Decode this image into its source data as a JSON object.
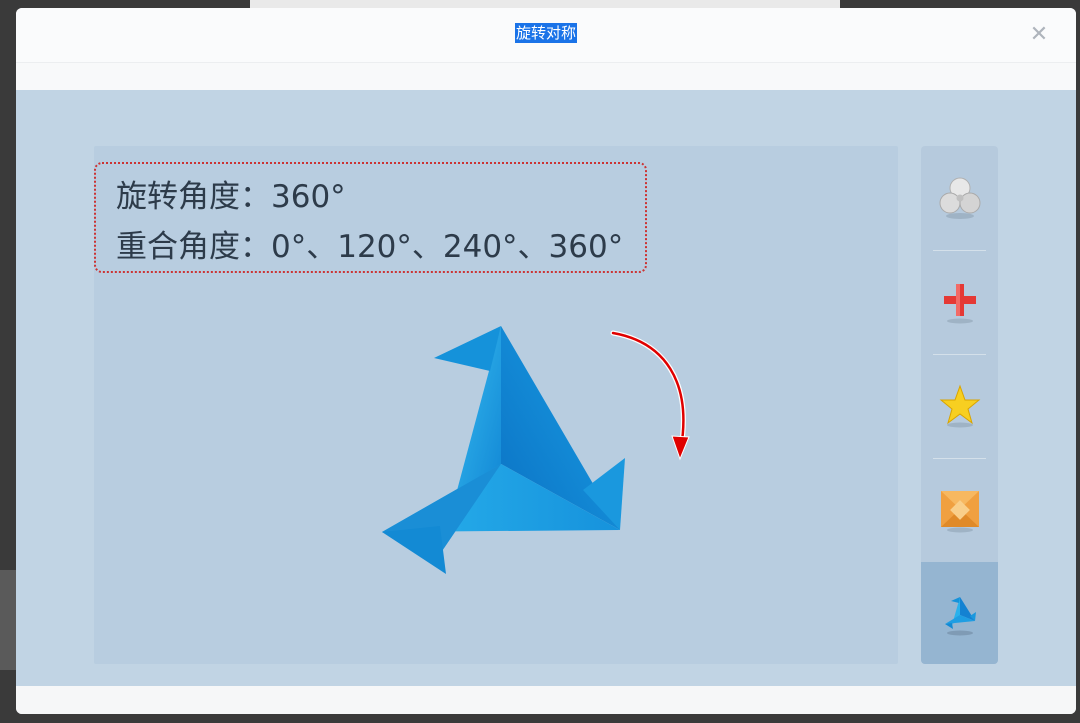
{
  "window": {
    "title": "旋转对称"
  },
  "info": {
    "rotation_label": "旋转角度：",
    "rotation_value": "360°",
    "overlap_label": "重合角度：",
    "overlap_value": "0°、120°、240°、360°"
  },
  "sidebar": {
    "items": [
      {
        "name": "fan",
        "icon": "fan-icon",
        "active": false
      },
      {
        "name": "cross",
        "icon": "plus-icon",
        "active": false
      },
      {
        "name": "star",
        "icon": "star-icon",
        "active": false
      },
      {
        "name": "pinwheel",
        "icon": "pinwheel-icon",
        "active": false
      },
      {
        "name": "paper-crane",
        "icon": "paper-crane-icon",
        "active": true
      }
    ]
  },
  "colors": {
    "shape_light": "#29b6ee",
    "shape_dark": "#0f80d0",
    "arrow": "#e00000",
    "active_item": "#95b5d1"
  }
}
